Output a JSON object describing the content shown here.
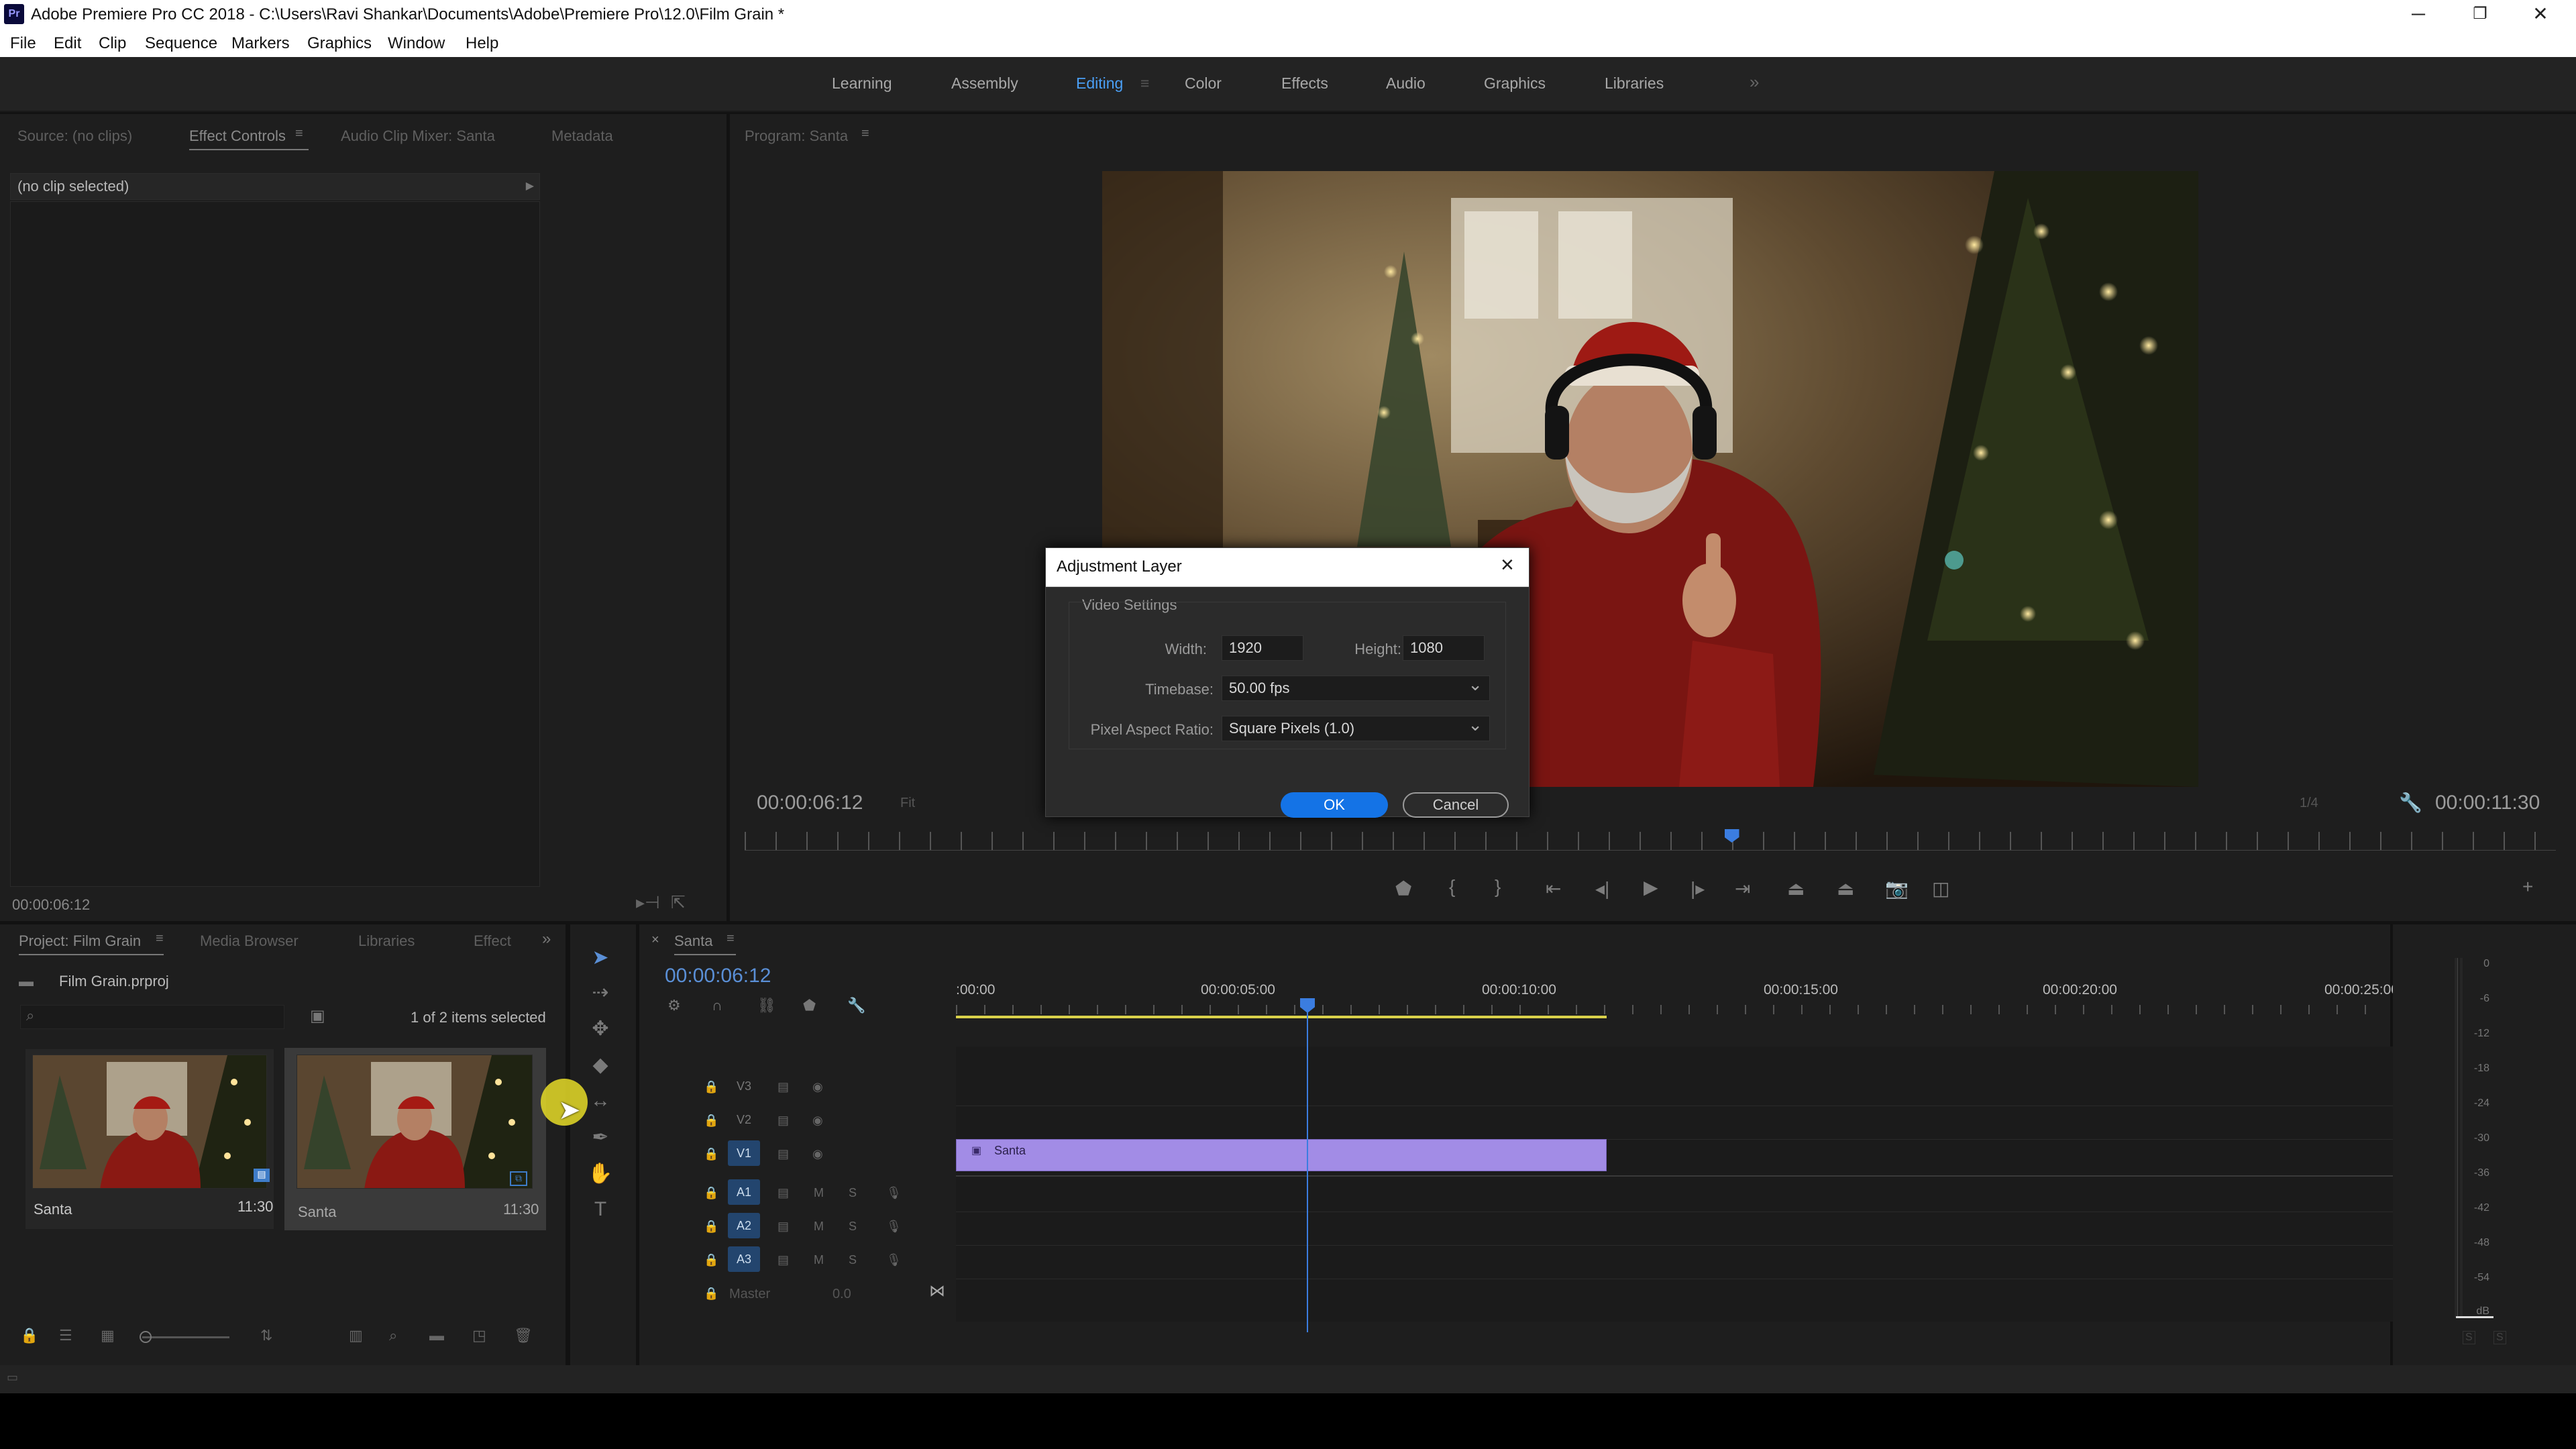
{
  "window": {
    "title": "Adobe Premiere Pro CC 2018 - C:\\Users\\Ravi Shankar\\Documents\\Adobe\\Premiere Pro\\12.0\\Film Grain *",
    "app_icon": "Pr",
    "minimize": "─",
    "restore": "❐",
    "close": "✕"
  },
  "menu": [
    "File",
    "Edit",
    "Clip",
    "Sequence",
    "Markers",
    "Graphics",
    "Window",
    "Help"
  ],
  "workspaces": {
    "items": [
      "Learning",
      "Assembly",
      "Editing",
      "Color",
      "Effects",
      "Audio",
      "Graphics",
      "Libraries"
    ],
    "active": "Editing",
    "more": "»"
  },
  "source_panel": {
    "tabs": [
      "Source: (no clips)",
      "Effect Controls",
      "Audio Clip Mixer: Santa",
      "Metadata"
    ],
    "active_tab": "Effect Controls",
    "no_clip": "(no clip selected)",
    "timecode": "00:00:06:12"
  },
  "program": {
    "tab": "Program: Santa",
    "timecode_left": "00:00:06:12",
    "fit": "Fit",
    "quality": "1/4",
    "timecode_right": "00:00:11:30",
    "playhead_fraction": 0.545
  },
  "dialog": {
    "title": "Adjustment Layer",
    "group": "Video Settings",
    "width_label": "Width:",
    "width_value": "1920",
    "height_label": "Height:",
    "height_value": "1080",
    "timebase_label": "Timebase:",
    "timebase_value": "50.00 fps",
    "par_label": "Pixel Aspect Ratio:",
    "par_value": "Square Pixels (1.0)",
    "ok": "OK",
    "cancel": "Cancel"
  },
  "project_panel": {
    "tabs": [
      "Project: Film Grain",
      "Media Browser",
      "Libraries",
      "Effect"
    ],
    "active_tab": "Project: Film Grain",
    "file": "Film Grain.prproj",
    "selection": "1 of 2 items selected",
    "items": [
      {
        "name": "Santa",
        "duration": "11:30"
      },
      {
        "name": "Santa",
        "duration": "11:30"
      }
    ]
  },
  "timeline": {
    "tab": "Santa",
    "timecode": "00:00:06:12",
    "ruler": [
      ":00:00",
      "00:00:05:00",
      "00:00:10:00",
      "00:00:15:00",
      "00:00:20:00",
      "00:00:25:00"
    ],
    "video_tracks": [
      "V3",
      "V2",
      "V1"
    ],
    "audio_tracks": [
      "A1",
      "A2",
      "A3"
    ],
    "master": "Master",
    "master_value": "0.0",
    "clip_name": "Santa",
    "mute": "M",
    "solo": "S"
  },
  "meter": {
    "scale": [
      "0",
      "-6",
      "-12",
      "-18",
      "-24",
      "-30",
      "-36",
      "-42",
      "-48",
      "-54",
      "dB"
    ],
    "solo_left": "S",
    "solo_right": "S"
  },
  "colors": {
    "accent": "#4a9ff5",
    "clip": "#a28ce6",
    "ok_button": "#1473e6",
    "playhead": "#3b7de0",
    "work_area": "#d8d04a"
  }
}
